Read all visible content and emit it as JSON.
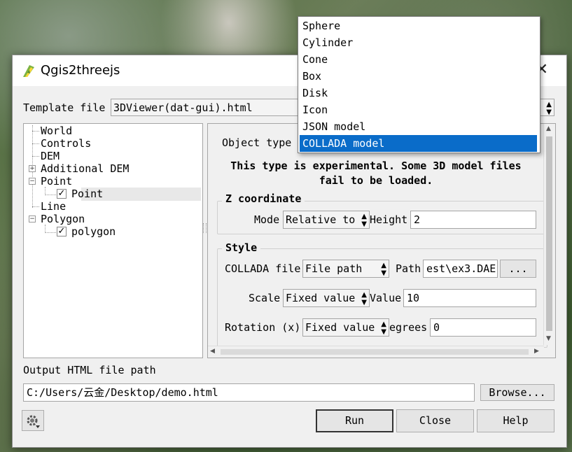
{
  "window": {
    "title": "Qgis2threejs"
  },
  "template": {
    "label": "Template file",
    "value": "3DViewer(dat-gui).html"
  },
  "tree": {
    "items": [
      {
        "label": "World"
      },
      {
        "label": "Controls"
      },
      {
        "label": "DEM"
      },
      {
        "label": "Additional DEM"
      },
      {
        "label": "Point"
      },
      {
        "label": "Point"
      },
      {
        "label": "Line"
      },
      {
        "label": "Polygon"
      },
      {
        "label": "polygon"
      }
    ]
  },
  "properties": {
    "object_type_label": "Object type",
    "warning": "This type is experimental. Some 3D model files",
    "warning_line2": "fail to be loaded.",
    "z": {
      "title": "Z coordinate",
      "mode_label": "Mode",
      "mode_value": "Relative to",
      "height_label": "Height",
      "height_value": "2"
    },
    "style": {
      "title": "Style",
      "collada_label": "COLLADA file",
      "collada_value": "File path",
      "path_label": "Path",
      "path_value": "est\\ex3.DAE",
      "browse_label": "...",
      "scale_label": "Scale",
      "scale_value": "Fixed value",
      "value_label": "Value",
      "value_value": "10",
      "rotation_label": "Rotation (x)",
      "rotation_value": "Fixed value",
      "degrees_label": "egrees",
      "degrees_value": "0"
    }
  },
  "dropdown": {
    "options": [
      "Sphere",
      "Cylinder",
      "Cone",
      "Box",
      "Disk",
      "Icon",
      "JSON model",
      "COLLADA model"
    ],
    "selected": "COLLADA model"
  },
  "output": {
    "label": "Output HTML file path",
    "value": "C:/Users/云金/Desktop/demo.html",
    "browse_label": "Browse..."
  },
  "buttons": {
    "run": "Run",
    "close": "Close",
    "help": "Help"
  }
}
